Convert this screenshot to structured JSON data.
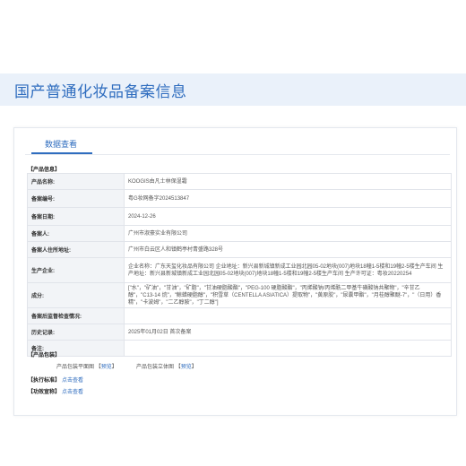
{
  "header": {
    "title": "国产普通化妆品备案信息"
  },
  "tab": {
    "label": "数据查看"
  },
  "sections": {
    "product_info": "【产品信息】",
    "packaging": "【产品包装】",
    "exec_standard": "【执行标准】",
    "efficacy": "【功效宣称】"
  },
  "rows": [
    {
      "label": "产品名称:",
      "value": "KOOGIS由凡士林保湿霜"
    },
    {
      "label": "备案编号:",
      "value": "粤G妆网备字2024513847"
    },
    {
      "label": "备案日期:",
      "value": "2024-12-26"
    },
    {
      "label": "备案人:",
      "value": "广州市淑豪实业有限公司"
    },
    {
      "label": "备案人住所地址:",
      "value": "广州市白云区人和镇鹤亭村青盛路328号"
    },
    {
      "label": "生产企业:",
      "value": "企业名称：广东天玺化妆品有限公司 企业地址：新兴县新城镇新成工业园北园05-02地块(007)地块18幢1-5楼和19幢2-5楼生产车间 生产地址：新兴县新城镇新成工业园北园05-02地块(007)地块18幢1-5楼和19幢2-5楼生产车间 生产许可证：粤妆20220254"
    },
    {
      "label": "成分:",
      "value": "[\"水\"，\"矿油\"，\"甘油\"，\"矿脂\"，\"甘油硬脂酸酯\"，\"PEG-100 硬脂酸酯\"，\"丙烯酸钠/丙烯酰二甲基牛磺酸钠共聚物\"，\"辛甘乙醇\"，\"C13-14 烷\"，\"鲸蜡硬脂醇\"，\"积雪草（CENTELLA ASIATICA）提取物\"，\"黄原胶\"，\"尿囊甲酯\"，\"月桂醇聚醚-7\"，\"（日用）香精\"，\"卡波姆\"，\"二乙醇胺\"，\"丁二醇\"]"
    },
    {
      "label": "备案后监督检查情况:",
      "value": ""
    },
    {
      "label": "历史记录:",
      "value": "2025年01月02日 首次备案"
    },
    {
      "label": "备注:",
      "value": ""
    }
  ],
  "packaging": {
    "flat_label": "产品包装平面图",
    "solid_label": "产品包装立体图",
    "preview_link": "预览",
    "bracket_open": "【",
    "bracket_close": "】"
  },
  "links": {
    "exec_standard": "点击查看",
    "efficacy": "点击查看"
  },
  "colors": {
    "accent": "#2f6dbf",
    "banner_bg": "#eaf1fa",
    "label_bg": "#f2f4f7"
  }
}
